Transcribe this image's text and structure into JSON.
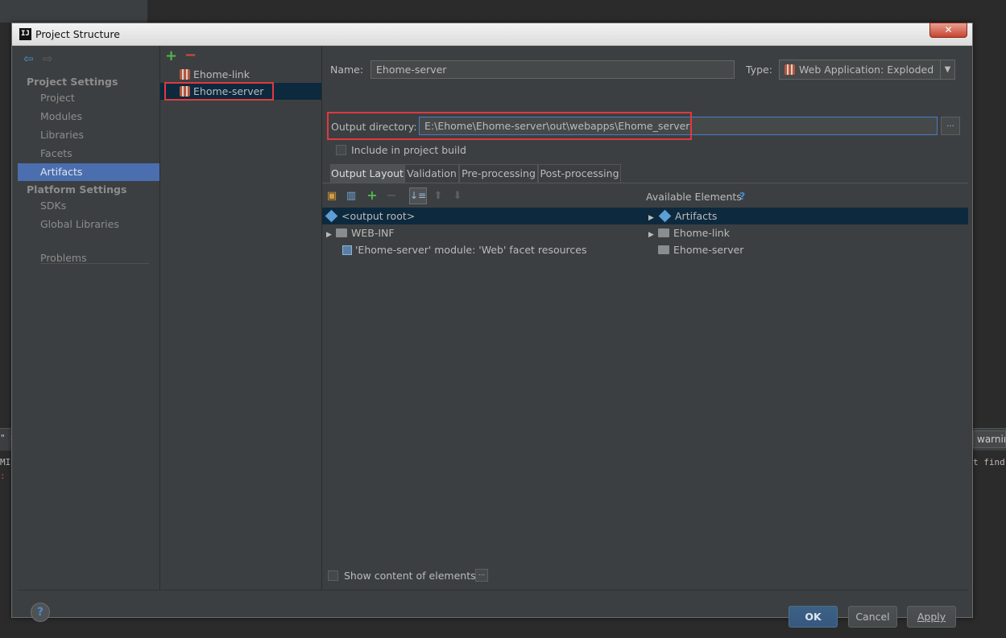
{
  "background": {
    "right_tab_label": "warnin",
    "console_left_lines": [
      "\" >",
      "MI",
      ": I"
    ],
    "console_right_line": "t find"
  },
  "dialog": {
    "title": "Project Structure",
    "close_glyph": "✕",
    "title_icon_text": "IJ"
  },
  "nav": {
    "project_settings_header": "Project Settings",
    "project_items": [
      "Project",
      "Modules",
      "Libraries",
      "Facets",
      "Artifacts"
    ],
    "platform_settings_header": "Platform Settings",
    "platform_items": [
      "SDKs",
      "Global Libraries"
    ],
    "problems": "Problems",
    "selected": "Artifacts"
  },
  "artifacts": {
    "items": [
      "Ehome-link",
      "Ehome-server"
    ],
    "selected": "Ehome-server"
  },
  "details": {
    "name_label": "Name:",
    "name_value": "Ehome-server",
    "type_label": "Type:",
    "type_value": "Web Application: Exploded",
    "output_label": "Output directory:",
    "output_value": "E:\\Ehome\\Ehome-server\\out\\webapps\\Ehome_server",
    "browse_label": "...",
    "include_build_label": "Include in project build",
    "include_build_checked": false
  },
  "tabs": [
    "Output Layout",
    "Validation",
    "Pre-processing",
    "Post-processing"
  ],
  "active_tab": "Output Layout",
  "layout_tree": {
    "root": "<output root>",
    "children": [
      "WEB-INF",
      "'Ehome-server' module: 'Web' facet resources"
    ]
  },
  "available": {
    "header": "Available Elements",
    "help": "?",
    "items": [
      "Artifacts",
      "Ehome-link",
      "Ehome-server"
    ]
  },
  "footer": {
    "show_content_label": "Show content of elements",
    "show_content_more": "...",
    "help": "?",
    "ok": "OK",
    "cancel": "Cancel",
    "apply": "Apply"
  },
  "colors": {
    "selection": "#4b6eaf",
    "tree_selection": "#0d293e",
    "highlight": "#e0393e",
    "add": "#4fb84a",
    "remove": "#d04b3a"
  }
}
